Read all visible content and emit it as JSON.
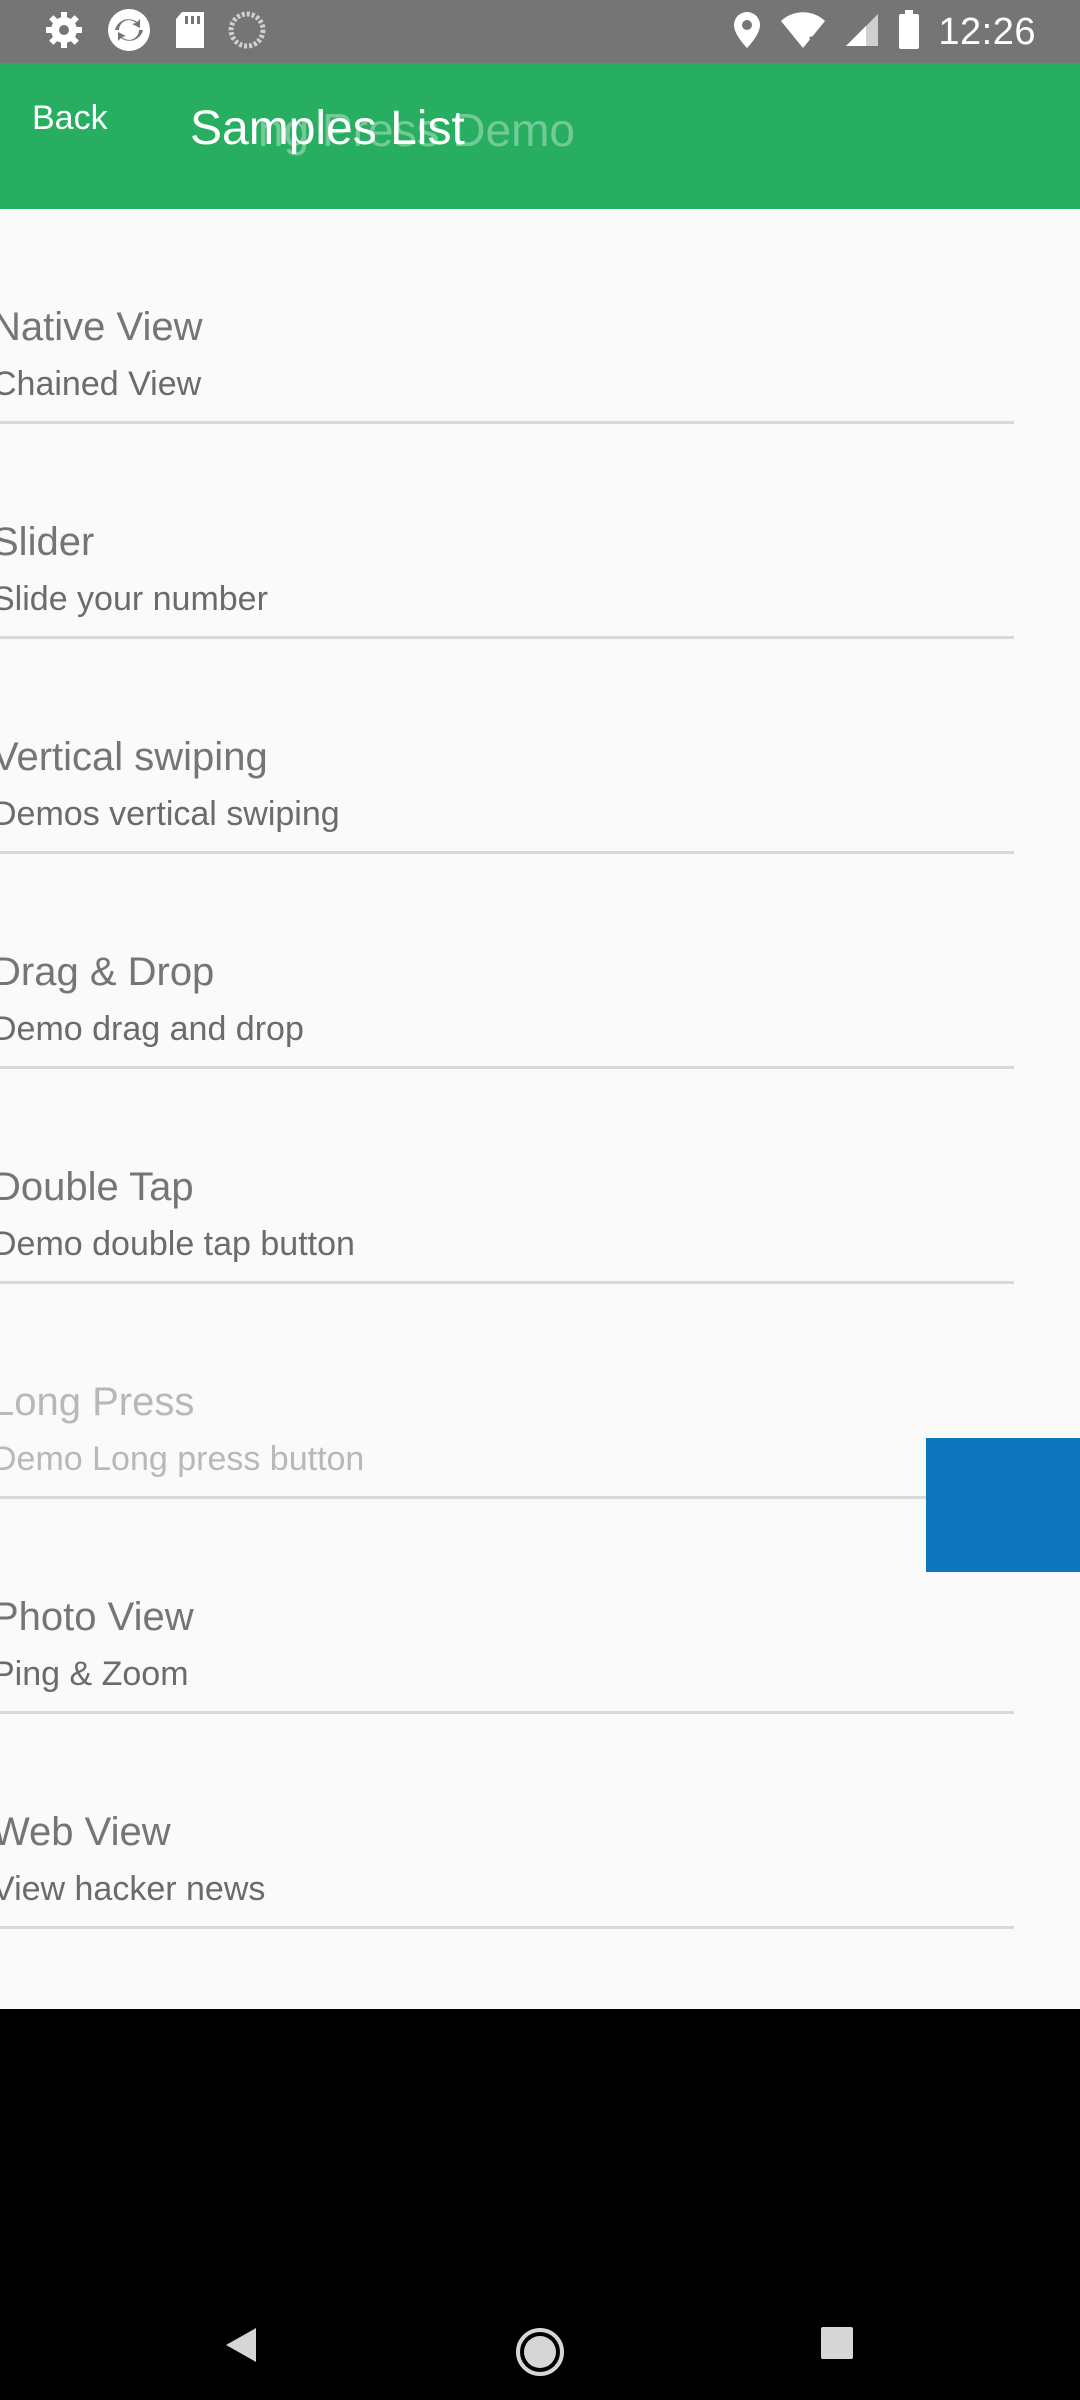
{
  "status_bar": {
    "time": "12:26",
    "left_icons": [
      "settings-icon",
      "sync-icon",
      "sd-card-icon",
      "loading-icon"
    ],
    "right_icons": [
      "location-icon",
      "wifi-icon",
      "signal-icon",
      "battery-icon"
    ]
  },
  "app_bar": {
    "back_label": "Back",
    "title": "Samples List",
    "ghost_title": "ng Press Demo",
    "background_color": "#27ae60"
  },
  "list": {
    "items": [
      {
        "title": "Native View",
        "subtitle": "Chained View"
      },
      {
        "title": "Slider",
        "subtitle": "Slide your number"
      },
      {
        "title": "Vertical swiping",
        "subtitle": "Demos vertical swiping"
      },
      {
        "title": "Drag & Drop",
        "subtitle": "Demo drag and drop"
      },
      {
        "title": "Double Tap",
        "subtitle": "Demo double tap button"
      },
      {
        "title": "Long Press",
        "subtitle": "Demo Long press button"
      },
      {
        "title": "Photo View",
        "subtitle": "Ping & Zoom"
      },
      {
        "title": "Web View",
        "subtitle": "View hacker news"
      }
    ]
  },
  "accent_color": "#0e76bc",
  "nav_bar": {
    "icons": [
      "back-triangle-icon",
      "home-circle-icon",
      "recents-square-icon"
    ]
  }
}
